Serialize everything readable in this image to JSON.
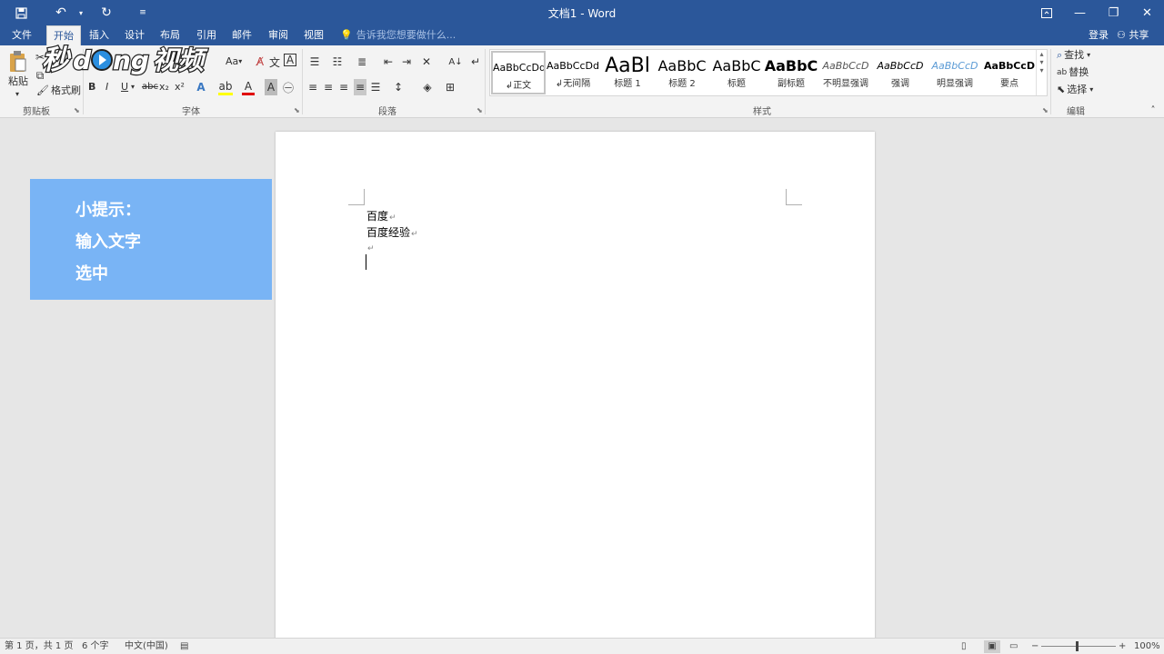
{
  "title_bar": {
    "title": "文档1 - Word"
  },
  "tabs": [
    "文件",
    "开始",
    "插入",
    "设计",
    "布局",
    "引用",
    "邮件",
    "审阅",
    "视图"
  ],
  "active_tab": "开始",
  "tell_me": "告诉我您想要做什么...",
  "account": {
    "login": "登录",
    "share": "共享"
  },
  "clipboard": {
    "paste": "粘贴",
    "format_painter": "格式刷",
    "group": "剪贴板"
  },
  "font": {
    "group": "字体",
    "bold": "B",
    "italic": "I",
    "underline": "U",
    "strike": "abc",
    "sub": "x₂",
    "sup": "x²",
    "aa": "Aa"
  },
  "paragraph": {
    "group": "段落"
  },
  "styles": {
    "group": "样式",
    "items": [
      {
        "preview": "AaBbCcDd",
        "name": "正文",
        "mark": "↲"
      },
      {
        "preview": "AaBbCcDd",
        "name": "无间隔",
        "mark": "↲"
      },
      {
        "preview": "AaBl",
        "name": "标题 1"
      },
      {
        "preview": "AaBbC",
        "name": "标题 2"
      },
      {
        "preview": "AaBbC",
        "name": "标题"
      },
      {
        "preview": "AaBbC",
        "name": "副标题"
      },
      {
        "preview": "AaBbCcD",
        "name": "不明显强调"
      },
      {
        "preview": "AaBbCcD",
        "name": "强调"
      },
      {
        "preview": "AaBbCcD",
        "name": "明显强调"
      },
      {
        "preview": "AaBbCcD",
        "name": "要点"
      }
    ]
  },
  "editing": {
    "find": "查找",
    "replace": "替换",
    "select": "选择",
    "group": "编辑"
  },
  "document": {
    "lines": [
      "百度",
      "百度经验",
      ""
    ],
    "paragraph_mark": "↵"
  },
  "tip_panel": {
    "lines": [
      "小提示：",
      "输入文字",
      "选中"
    ]
  },
  "watermark": "秒懂视频",
  "status_bar": {
    "page": "第 1 页，共 1 页",
    "words": "6 个字",
    "language": "中文(中国)",
    "zoom": "100%"
  },
  "colors": {
    "title_bar": "#2b579a",
    "tip_bg": "#79b4f5",
    "ribbon": "#f3f3f3"
  }
}
